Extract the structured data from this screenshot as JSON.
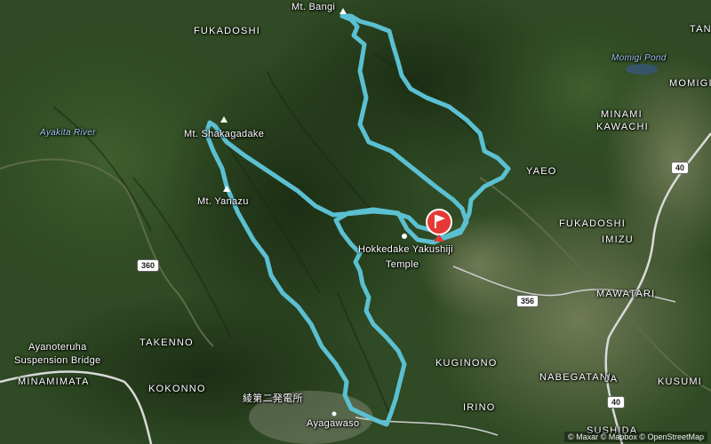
{
  "route": {
    "color": "#5bc0d1"
  },
  "peaks": {
    "bangi": "Mt. Bangi",
    "shakagadake": "Mt. Shakagadake",
    "yanazu": "Mt. Yanazu"
  },
  "places": {
    "fukadoshi_n": "FUKADOSHI",
    "fukadoshi_e": "FUKADOSHI",
    "tan": "TAN",
    "momigi": "MOMIGI",
    "minami_kawachi_1": "MINAMI",
    "minami_kawachi_2": "KAWACHI",
    "yaeo": "YAEO",
    "imizu": "IMIZU",
    "mawatari": "MAWATARI",
    "takenno": "TAKENNO",
    "minamimata": "MINAMIMATA",
    "kokonno": "KOKONNO",
    "kuginono": "KUGINONO",
    "nabegatani": "NABEGATANI",
    "ja": "JA",
    "kusumi": "KUSUMI",
    "irino": "IRINO",
    "sushida": "SUSHIDA"
  },
  "water": {
    "ayakita_river": "Ayakita River",
    "momigi_pond": "Momigi Pond"
  },
  "pois": {
    "temple_1": "Hokkedake Yakushiji",
    "temple_2": "Temple",
    "bridge_1": "Ayanoteruha",
    "bridge_2": "Suspension Bridge",
    "ayagawaso": "Ayagawaso",
    "power_station": "綾第二発電所"
  },
  "roads": {
    "r360": "360",
    "r356": "356",
    "r40a": "40",
    "r40b": "40"
  },
  "attribution": "© Maxar © Mapbox © OpenStreetMap"
}
